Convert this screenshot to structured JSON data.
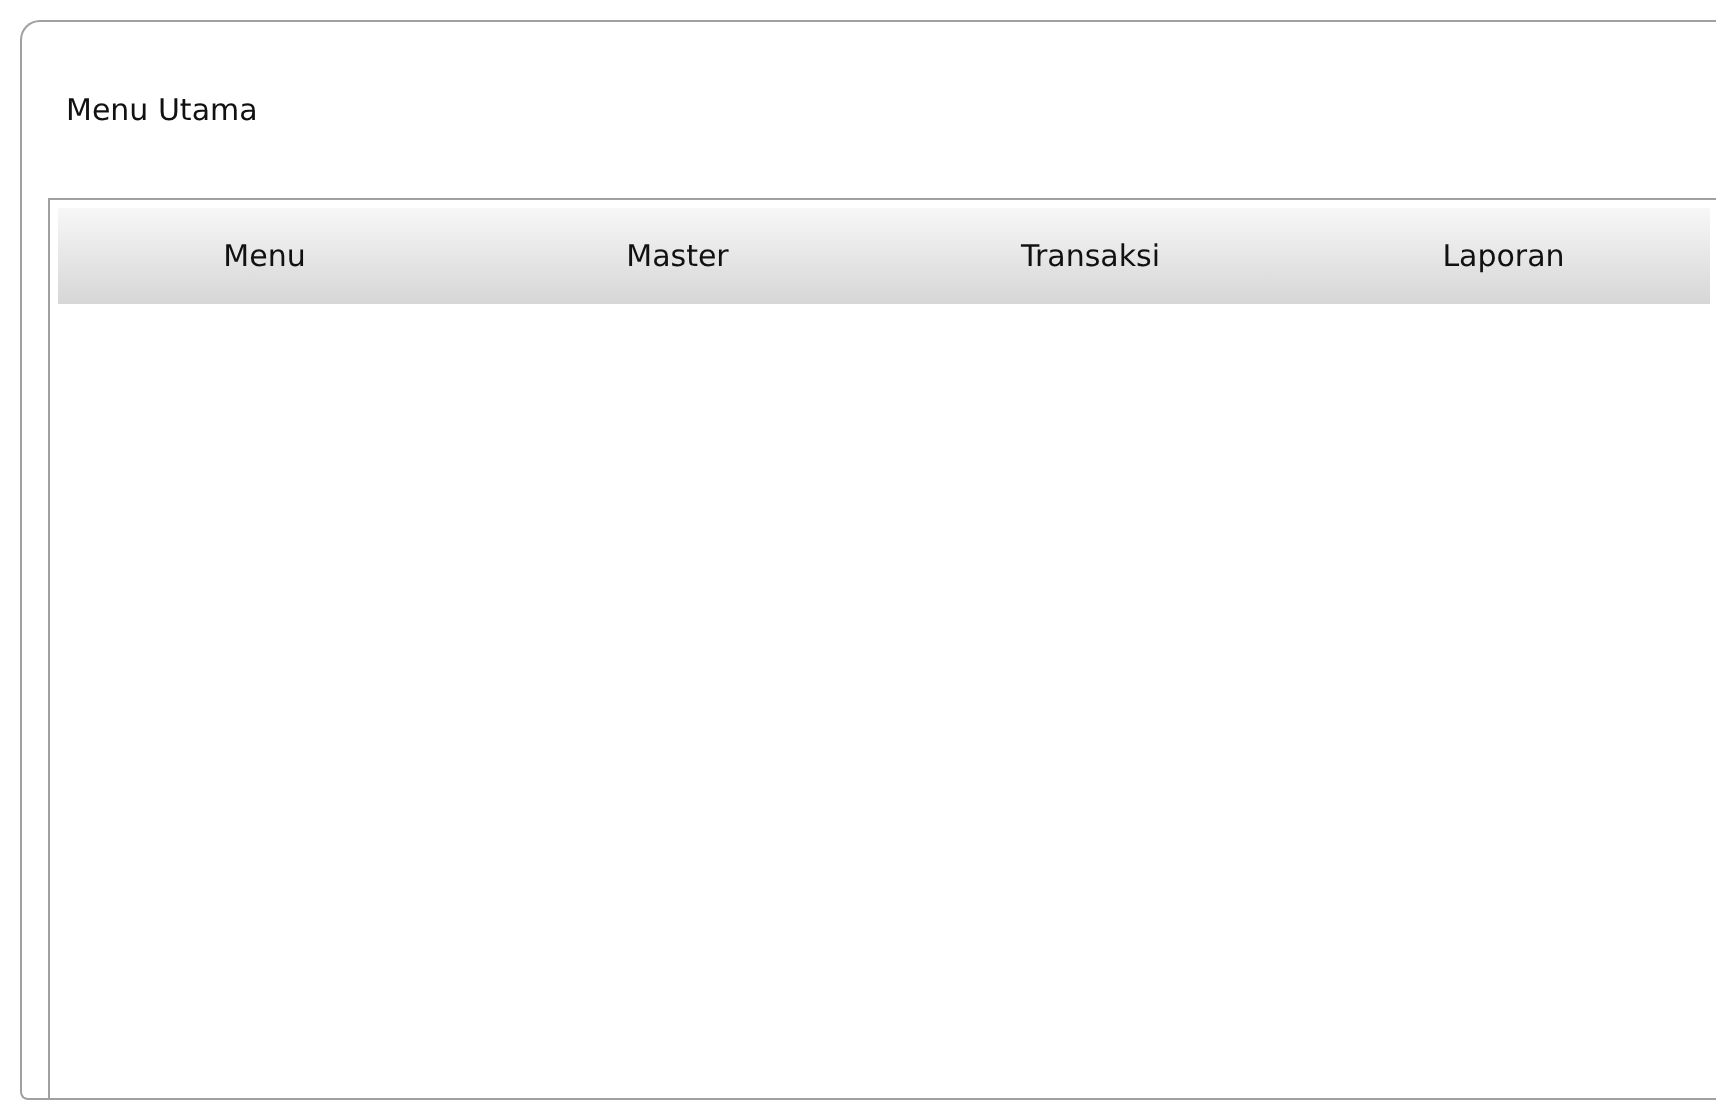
{
  "window": {
    "title": "Menu Utama"
  },
  "menu_bar": {
    "items": [
      {
        "label": "Menu"
      },
      {
        "label": "Master"
      },
      {
        "label": "Transaksi"
      },
      {
        "label": "Laporan"
      }
    ]
  }
}
